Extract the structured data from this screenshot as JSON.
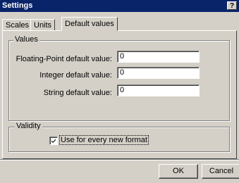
{
  "window": {
    "title": "Settings",
    "help_label": "?"
  },
  "tabs": [
    {
      "label": "Scales",
      "active": false
    },
    {
      "label": "Units",
      "active": false
    },
    {
      "label": "Default values",
      "active": true
    }
  ],
  "values_group": {
    "title": "Values",
    "fields": [
      {
        "label": "Floating-Point default value:",
        "value": "0"
      },
      {
        "label": "Integer default value:",
        "value": "0"
      },
      {
        "label": "String default value:",
        "value": "0"
      }
    ]
  },
  "validity_group": {
    "title": "Validity",
    "checkbox_label": "Use for every new format",
    "checked": true
  },
  "buttons": {
    "ok": "OK",
    "cancel": "Cancel"
  }
}
